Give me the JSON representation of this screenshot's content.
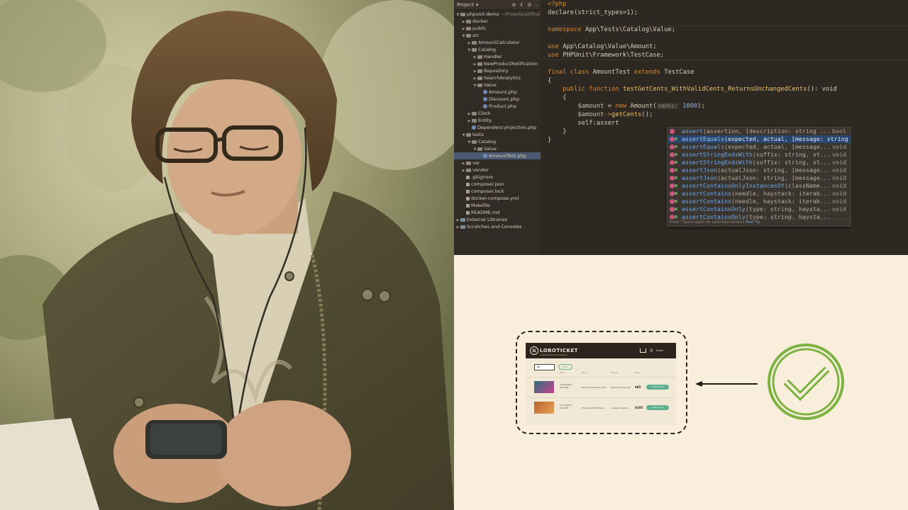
{
  "ide": {
    "project_label": "Project",
    "tree": [
      {
        "label": "phpunit-demo",
        "hint": "~/Projects/all/final",
        "indent": 0,
        "icon": "dir",
        "twisty": "open"
      },
      {
        "label": "docker",
        "indent": 1,
        "icon": "dir",
        "twisty": "closed"
      },
      {
        "label": "public",
        "indent": 1,
        "icon": "dir",
        "twisty": "closed"
      },
      {
        "label": "src",
        "indent": 1,
        "icon": "dir",
        "twisty": "open"
      },
      {
        "label": "AmountCalculator",
        "indent": 2,
        "icon": "dir",
        "twisty": "closed"
      },
      {
        "label": "Catalog",
        "indent": 2,
        "icon": "dir",
        "twisty": "open"
      },
      {
        "label": "Handler",
        "indent": 3,
        "icon": "dir",
        "twisty": "closed"
      },
      {
        "label": "NewProductNotification",
        "indent": 3,
        "icon": "dir",
        "twisty": "closed"
      },
      {
        "label": "Repository",
        "indent": 3,
        "icon": "dir",
        "twisty": "closed"
      },
      {
        "label": "SearchAnalytics",
        "indent": 3,
        "icon": "dir",
        "twisty": "closed"
      },
      {
        "label": "Value",
        "indent": 3,
        "icon": "dir",
        "twisty": "open"
      },
      {
        "label": "Amount.php",
        "indent": 4,
        "icon": "php",
        "twisty": "none"
      },
      {
        "label": "Discount.php",
        "indent": 4,
        "icon": "php",
        "twisty": "none"
      },
      {
        "label": "Product.php",
        "indent": 4,
        "icon": "php",
        "twisty": "none"
      },
      {
        "label": "Clock",
        "indent": 2,
        "icon": "dir",
        "twisty": "closed"
      },
      {
        "label": "Entity",
        "indent": 2,
        "icon": "dir",
        "twisty": "closed"
      },
      {
        "label": "DependencyInjection.php",
        "indent": 2,
        "icon": "php",
        "twisty": "none"
      },
      {
        "label": "tests",
        "indent": 1,
        "icon": "dir",
        "twisty": "open"
      },
      {
        "label": "Catalog",
        "indent": 2,
        "icon": "dir",
        "twisty": "open"
      },
      {
        "label": "Value",
        "indent": 3,
        "icon": "dir",
        "twisty": "open"
      },
      {
        "label": "AmountTest.php",
        "indent": 4,
        "icon": "php",
        "twisty": "none",
        "selected": true
      },
      {
        "label": "var",
        "indent": 1,
        "icon": "dir",
        "twisty": "closed"
      },
      {
        "label": "vendor",
        "indent": 1,
        "icon": "dir",
        "twisty": "closed"
      },
      {
        "label": ".gitignore",
        "indent": 1,
        "icon": "txt",
        "twisty": "none"
      },
      {
        "label": "composer.json",
        "indent": 1,
        "icon": "txt",
        "twisty": "none"
      },
      {
        "label": "composer.lock",
        "indent": 1,
        "icon": "txt",
        "twisty": "none"
      },
      {
        "label": "docker-compose.yml",
        "indent": 1,
        "icon": "txt",
        "twisty": "none"
      },
      {
        "label": "Makefile",
        "indent": 1,
        "icon": "txt",
        "twisty": "none"
      },
      {
        "label": "README.md",
        "indent": 1,
        "icon": "txt",
        "twisty": "none"
      },
      {
        "label": "External Libraries",
        "indent": 0,
        "icon": "lib",
        "twisty": "closed"
      },
      {
        "label": "Scratches and Consoles",
        "indent": 0,
        "icon": "lib",
        "twisty": "closed"
      }
    ],
    "code": {
      "php_open": "<?php",
      "declare_line": "declare(strict_types=1);",
      "ns_kw": "namespace",
      "ns_name": "App\\Tests\\Catalog\\Value;",
      "use_kw": "use",
      "use1": "App\\Catalog\\Value\\Amount;",
      "use2": "PHPUnit\\Framework\\TestCase;",
      "final_kw": "final class",
      "class_name": "AmountTest",
      "extends_kw": "extends",
      "parent_class": "TestCase",
      "open_brace": "{",
      "close_brace": "}",
      "method_kw": "public function",
      "method_name": "testGetCents_WithValidCents_ReturnsUnchangedCents",
      "method_sig_rest": "(): void",
      "var_amount": "$amount",
      "assign": " = ",
      "new_kw": "new",
      "amount_call": "Amount(",
      "param_hint": "cents:",
      "num": "1000",
      "close_call": ");",
      "arrow_call": "->",
      "get_cents": "getCents",
      "get_cents_end": "();",
      "self_line": "self:assert"
    },
    "autocomplete": {
      "items": [
        {
          "method": "assert",
          "params": "(assertion, [description: string ...",
          "ret": "bool",
          "selected": false,
          "lock": false
        },
        {
          "method": "assertEquals",
          "params": "(expected, actual, [message: string",
          "ret": "",
          "selected": true,
          "lock": true
        },
        {
          "method": "assertEquals",
          "params": "(expected, actual, [message...",
          "ret": "void",
          "selected": false,
          "lock": true
        },
        {
          "method": "assertStringEndsWith",
          "params": "(suffix: string, st...",
          "ret": "void",
          "selected": false,
          "lock": true
        },
        {
          "method": "assertStringEndsWith",
          "params": "(suffix: string, st...",
          "ret": "void",
          "selected": false,
          "lock": true
        },
        {
          "method": "assertJson",
          "params": "(actualJson: string, [message...",
          "ret": "void",
          "selected": false,
          "lock": true
        },
        {
          "method": "assertJson",
          "params": "(actualJson: string, [message...",
          "ret": "void",
          "selected": false,
          "lock": true
        },
        {
          "method": "assertContainsOnlyInstancesOf",
          "params": "(className...",
          "ret": "void",
          "selected": false,
          "lock": true
        },
        {
          "method": "assertContains",
          "params": "(needle, haystack: iterab...",
          "ret": "void",
          "selected": false,
          "lock": true
        },
        {
          "method": "assertContains",
          "params": "(needle, haystack: iterab...",
          "ret": "void",
          "selected": false,
          "lock": true
        },
        {
          "method": "assertContainsOnly",
          "params": "(type: string, haysta...",
          "ret": "void",
          "selected": false,
          "lock": true
        },
        {
          "method": "assertContainsOnly",
          "params": "(type: string, haysta...",
          "ret": "",
          "selected": false,
          "lock": true
        }
      ],
      "footer": "Press ^Space again for extended variants",
      "footer_link": "Next Tip"
    }
  },
  "diagram": {
    "mock": {
      "logo_letter": "G",
      "logo_text": "LOBOTICKET",
      "logo_sub": "A Globomantics Company",
      "cart_label": "0",
      "cart_sub": "Items",
      "filter_value": "All",
      "filter_btn": "Filter",
      "col_headers": [
        "Date",
        "Band",
        "Venue",
        "Price"
      ],
      "rows": [
        {
          "date": "12/13/2021",
          "time": "8:00 PM",
          "band": "Moonshine Shoes Club",
          "venue": "Moonshine Garden",
          "price": "$65",
          "btn": "Add to Cart",
          "thumb_a": "#2b6f7a",
          "thumb_b": "#c9408f"
        },
        {
          "date": "12/13/2021",
          "time": "8:00 PM",
          "band": "The Silent Mind Band",
          "venue": "Liverpool Rooms",
          "price": "$105",
          "btn": "Add to Cart",
          "thumb_a": "#b8632b",
          "thumb_b": "#e6a35a"
        }
      ]
    },
    "check_color": "#7cb342",
    "arrow_color": "#1f1a15"
  }
}
